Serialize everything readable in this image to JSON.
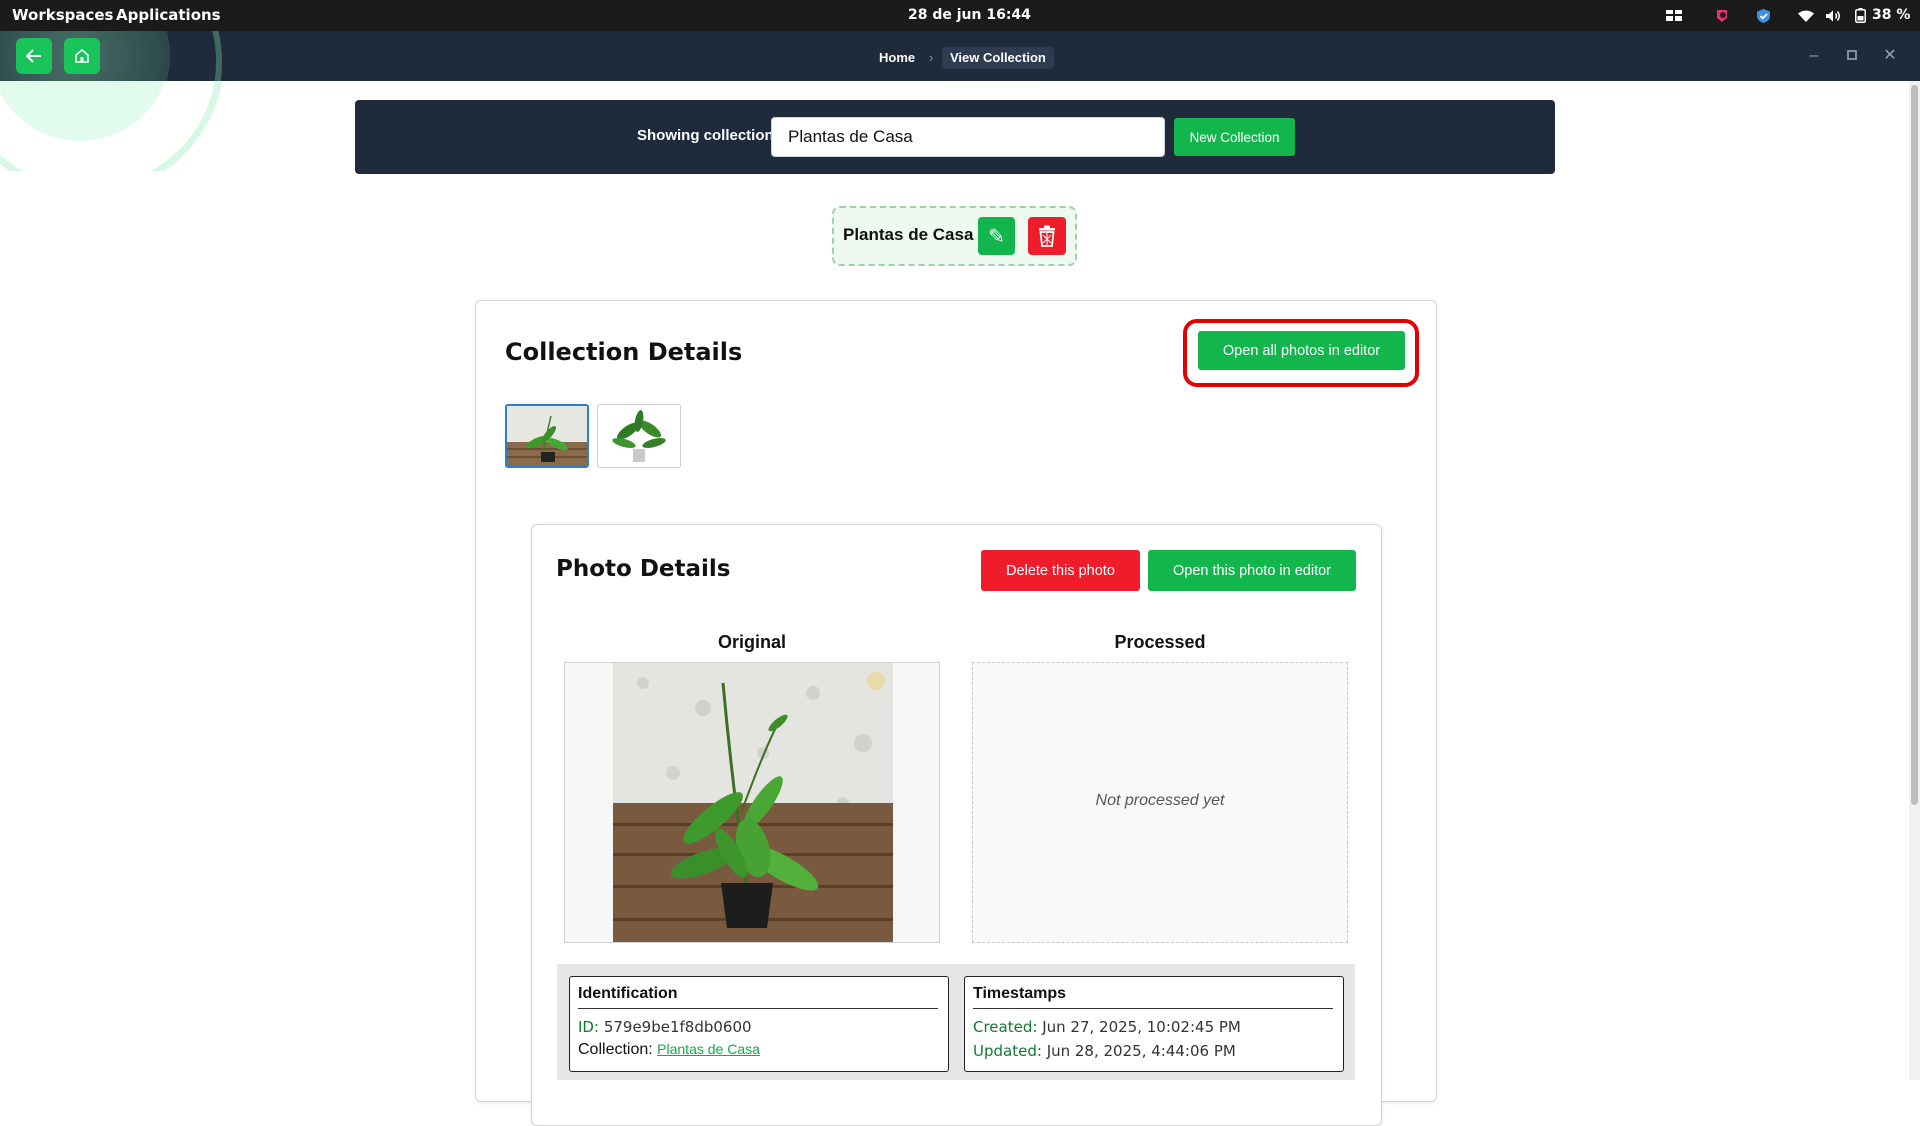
{
  "system_bar": {
    "workspaces": "Workspaces",
    "applications": "Applications",
    "datetime": "28 de jun  16:44",
    "battery": "38 %"
  },
  "app_header": {
    "breadcrumb": [
      "Home",
      "View Collection"
    ]
  },
  "collection_selector": {
    "label": "Showing collection:",
    "value": "Plantas de Casa",
    "new_button": "New Collection"
  },
  "collection_chip": {
    "name": "Plantas de Casa"
  },
  "collection_details": {
    "title": "Collection Details",
    "open_all_button": "Open all photos in editor"
  },
  "photo_details": {
    "title": "Photo Details",
    "delete_button": "Delete this photo",
    "open_button": "Open this photo in editor",
    "original_label": "Original",
    "processed_label": "Processed",
    "processed_placeholder": "Not processed yet"
  },
  "identification": {
    "title": "Identification",
    "id_key": "ID:",
    "id_value": "579e9be1f8db0600",
    "collection_key": "Collection:",
    "collection_value": "Plantas de Casa"
  },
  "timestamps": {
    "title": "Timestamps",
    "created_key": "Created:",
    "created_value": "Jun 27, 2025, 10:02:45 PM",
    "updated_key": "Updated:",
    "updated_value": "Jun 28, 2025, 4:44:06 PM"
  },
  "colors": {
    "accent_green": "#12b64c",
    "danger_red": "#ef1c2c",
    "header_navy": "#1f2a3b",
    "highlight_red": "#e30000"
  }
}
